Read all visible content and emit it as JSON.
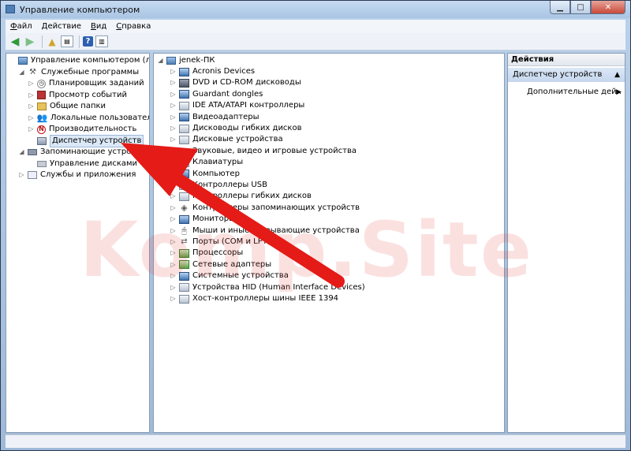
{
  "window": {
    "title": "Управление компьютером"
  },
  "menu": [
    {
      "label": "Файл",
      "key": "Ф",
      "rest": "айл"
    },
    {
      "label": "Действие",
      "key": "Д",
      "rest": "ействие"
    },
    {
      "label": "Вид",
      "key": "В",
      "rest": "ид"
    },
    {
      "label": "Справка",
      "key": "С",
      "rest": "правка"
    }
  ],
  "left_tree": [
    {
      "label": "Управление компьютером (локальн",
      "level": 0,
      "expander": "",
      "icon": "computer-management-icon"
    },
    {
      "label": "Служебные программы",
      "level": 1,
      "expander": "◢",
      "icon": "system-tools-icon"
    },
    {
      "label": "Планировщик заданий",
      "level": 2,
      "expander": "▷",
      "icon": "task-scheduler-icon"
    },
    {
      "label": "Просмотр событий",
      "level": 2,
      "expander": "▷",
      "icon": "event-viewer-icon"
    },
    {
      "label": "Общие папки",
      "level": 2,
      "expander": "▷",
      "icon": "shared-folders-icon"
    },
    {
      "label": "Локальные пользователи и гр",
      "level": 2,
      "expander": "▷",
      "icon": "local-users-icon"
    },
    {
      "label": "Производительность",
      "level": 2,
      "expander": "▷",
      "icon": "performance-icon"
    },
    {
      "label": "Диспетчер устройств",
      "level": 2,
      "expander": "",
      "icon": "device-manager-icon",
      "selected": true
    },
    {
      "label": "Запоминающие устройств",
      "level": 1,
      "expander": "◢",
      "icon": "storage-icon"
    },
    {
      "label": "Управление дисками",
      "level": 2,
      "expander": "",
      "icon": "disk-management-icon"
    },
    {
      "label": "Службы и приложения",
      "level": 1,
      "expander": "▷",
      "icon": "services-apps-icon"
    }
  ],
  "device_tree": {
    "root": "jenek-ПК",
    "items": [
      {
        "label": "Acronis Devices",
        "style": "blue"
      },
      {
        "label": "DVD и CD-ROM дисководы",
        "style": "dark"
      },
      {
        "label": "Guardant dongles",
        "style": "blue"
      },
      {
        "label": "IDE ATA/ATAPI контроллеры",
        "style": ""
      },
      {
        "label": "Видеоадаптеры",
        "style": "blue"
      },
      {
        "label": "Дисководы гибких дисков",
        "style": ""
      },
      {
        "label": "Дисковые устройства",
        "style": ""
      },
      {
        "label": "Звуковые, видео и игровые устройства",
        "style": "sound"
      },
      {
        "label": "Клавиатуры",
        "style": ""
      },
      {
        "label": "Компьютер",
        "style": "blue"
      },
      {
        "label": "Контроллеры USB",
        "style": ""
      },
      {
        "label": "Контроллеры гибких дисков",
        "style": ""
      },
      {
        "label": "Контроллеры запоминающих устройств",
        "style": "diamond"
      },
      {
        "label": "Мониторы",
        "style": "blue"
      },
      {
        "label": "Мыши и иные указывающие устройства",
        "style": "mouse"
      },
      {
        "label": "Порты (COM и LPT)",
        "style": "port"
      },
      {
        "label": "Процессоры",
        "style": "green"
      },
      {
        "label": "Сетевые адаптеры",
        "style": "green"
      },
      {
        "label": "Системные устройства",
        "style": "blue"
      },
      {
        "label": "Устройства HID (Human Interface Devices)",
        "style": ""
      },
      {
        "label": "Хост-контроллеры шины IEEE 1394",
        "style": ""
      }
    ]
  },
  "actions": {
    "header": "Действия",
    "section": "Диспетчер устройств",
    "more": "Дополнительные дей..."
  },
  "watermark": "Komp.Site",
  "colors": {
    "arrow": "#e41b17",
    "selection": "#dbe8f7",
    "title_bar": "#b9d1ea"
  }
}
